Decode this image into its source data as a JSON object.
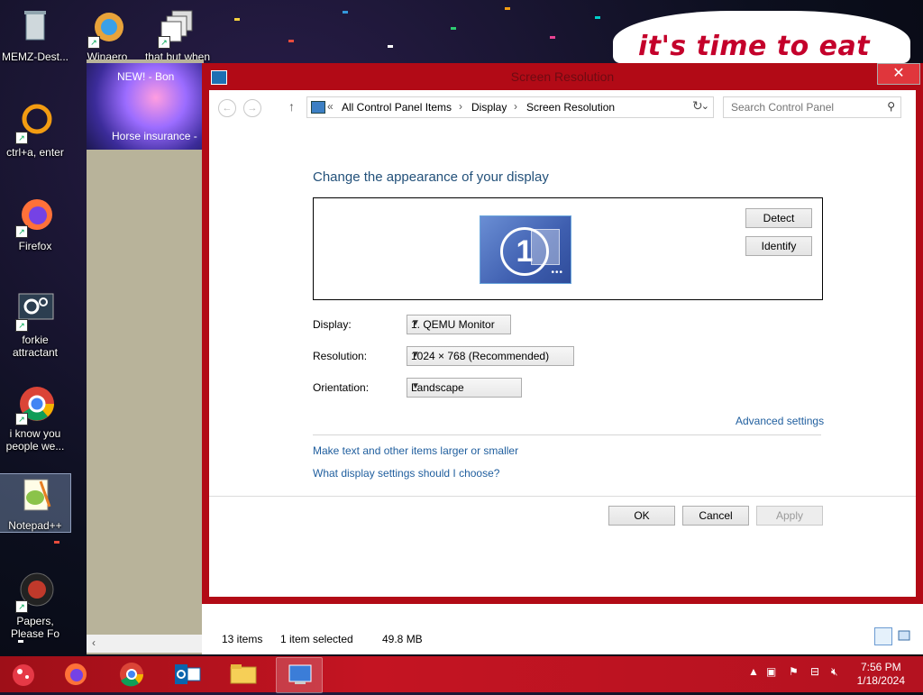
{
  "desktop": {
    "icons": [
      {
        "label": "MEMZ-Dest..."
      },
      {
        "label": "ctrl+a, enter"
      },
      {
        "label": "Firefox"
      },
      {
        "label": "forkie attractant"
      },
      {
        "label": "i know you people we..."
      },
      {
        "label": "Notepad++"
      },
      {
        "label": "Papers, Please Fo"
      },
      {
        "label": "Winaero"
      },
      {
        "label": "that but when"
      }
    ],
    "banner_text": "it's time to eat shit"
  },
  "background_window": {
    "tab_title": "NEW! - Bon",
    "item_label": "Horse insurance -"
  },
  "window": {
    "title": "Screen Resolution",
    "close_glyph": "✕",
    "address": {
      "overflow": "«",
      "crumbs": [
        "All Control Panel Items",
        "Display",
        "Screen Resolution"
      ],
      "separator": "›"
    },
    "search_placeholder": "Search Control Panel",
    "heading": "Change the appearance of your display",
    "monitor_number": "1",
    "detect_label": "Detect",
    "identify_label": "Identify",
    "fields": {
      "display_label": "Display:",
      "display_value": "1. QEMU Monitor",
      "resolution_label": "Resolution:",
      "resolution_value": "1024 × 768 (Recommended)",
      "orientation_label": "Orientation:",
      "orientation_value": "Landscape"
    },
    "advanced_link": "Advanced settings",
    "link_larger": "Make text and other items larger or smaller",
    "link_choose": "What display settings should I choose?",
    "ok_label": "OK",
    "cancel_label": "Cancel",
    "apply_label": "Apply"
  },
  "explorer_status": {
    "items": "13 items",
    "selected": "1 item selected",
    "size": "49.8 MB"
  },
  "taskbar": {
    "apps": [
      "firefox",
      "chrome",
      "outlook",
      "file-explorer",
      "control-panel"
    ],
    "clock_time": "7:56 PM",
    "clock_date": "1/18/2024"
  },
  "colors": {
    "window_frame": "#b20a16",
    "taskbar": "#c41422",
    "link": "#1f5e9e",
    "heading": "#23517a"
  }
}
